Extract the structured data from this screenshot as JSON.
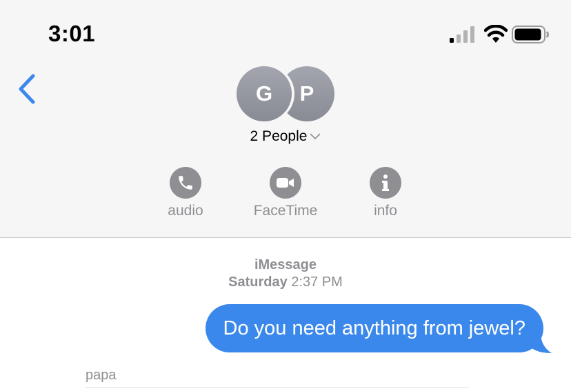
{
  "status_bar": {
    "time": "3:01",
    "signal_icon": "cellular-signal-icon",
    "wifi_icon": "wifi-icon",
    "battery_icon": "battery-icon"
  },
  "nav": {
    "back_icon": "chevron-left-icon"
  },
  "conversation": {
    "avatars": [
      {
        "initial": "G"
      },
      {
        "initial": "P"
      }
    ],
    "title": "2 People"
  },
  "actions": [
    {
      "label": "audio",
      "icon": "phone-icon"
    },
    {
      "label": "FaceTime",
      "icon": "video-camera-icon"
    },
    {
      "label": "info",
      "icon": "info-icon"
    }
  ],
  "thread": {
    "service": "iMessage",
    "day": "Saturday",
    "time": "2:37 PM",
    "messages": [
      {
        "direction": "outgoing",
        "text": "Do you need anything from jewel?"
      }
    ],
    "next_sender": "papa"
  },
  "colors": {
    "accent": "#3b88ec",
    "header_bg": "#f6f6f6",
    "gray": "#8e8e93"
  }
}
